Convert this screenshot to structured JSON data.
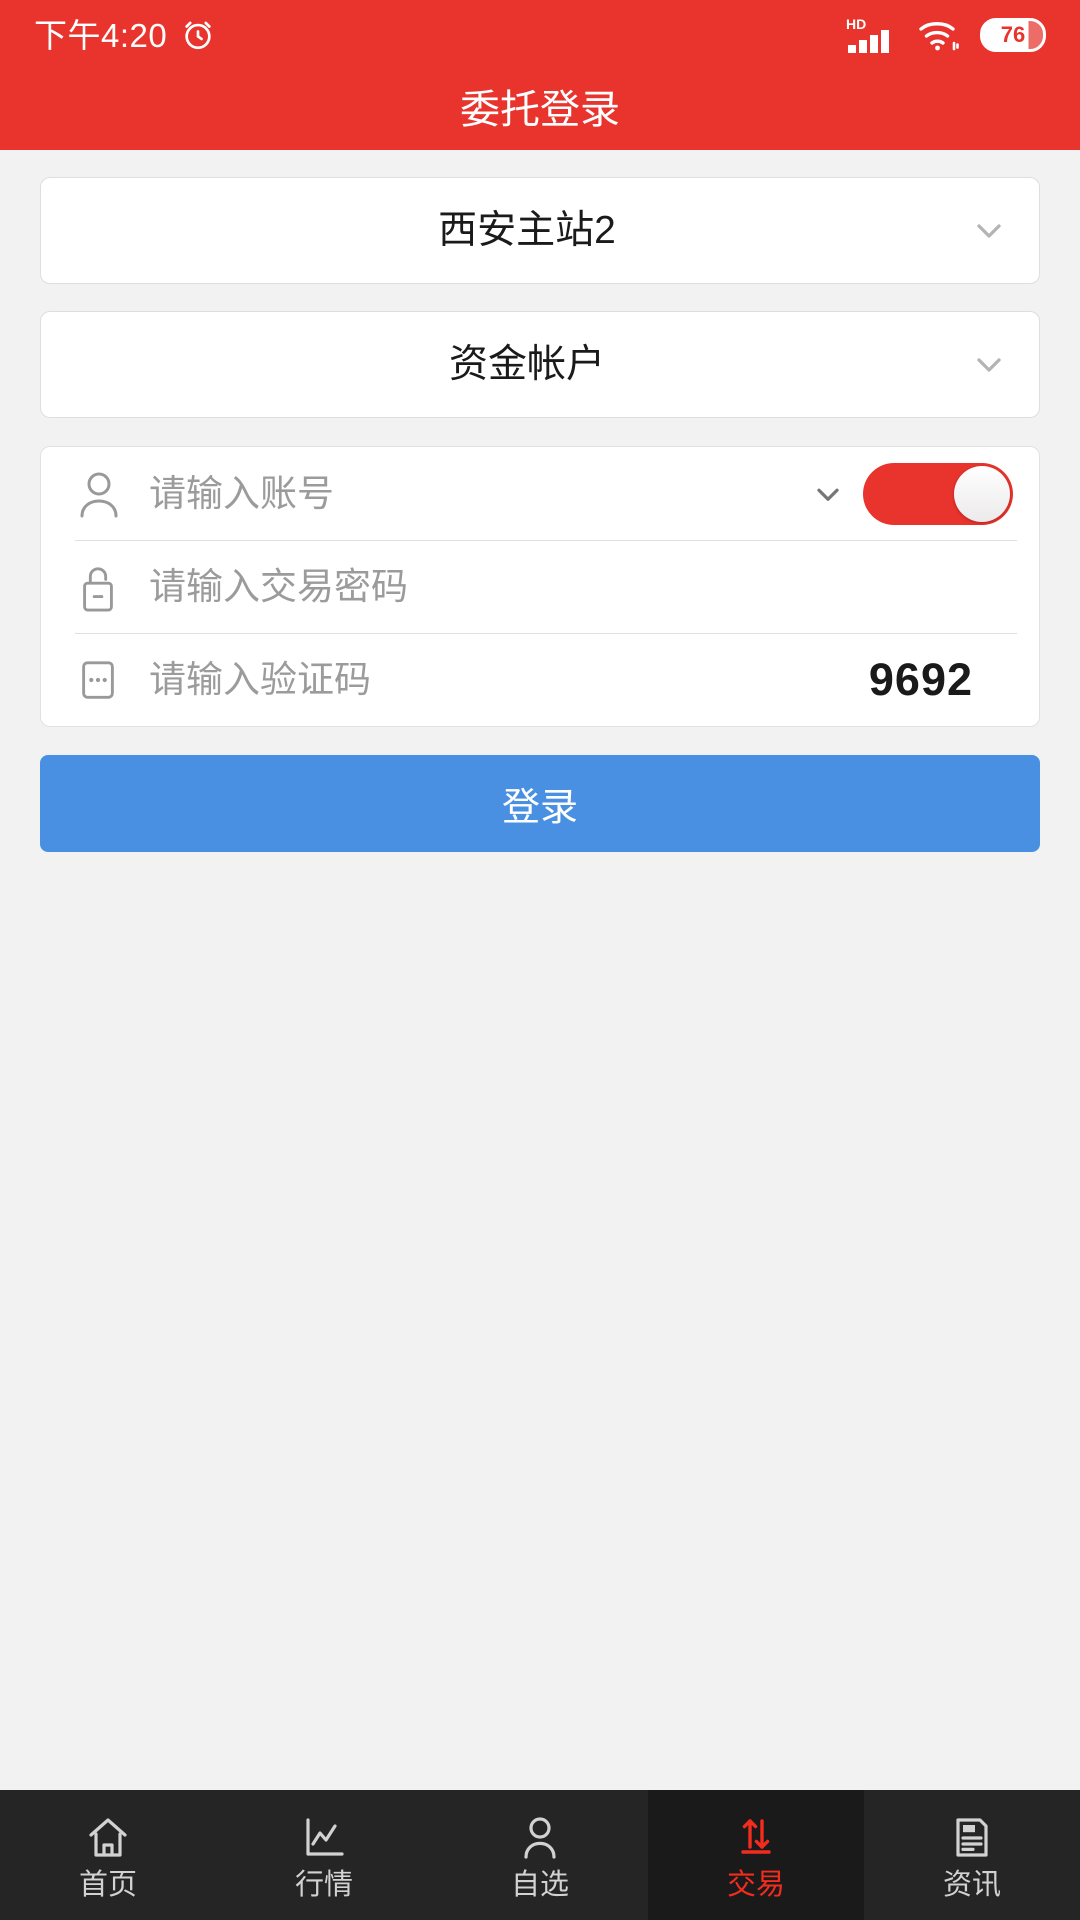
{
  "status_bar": {
    "time": "下午4:20",
    "alarm_icon": "alarm-clock-icon",
    "network_label": "HD",
    "signal_icon": "cellular-signal-icon",
    "wifi_icon": "wifi-icon",
    "battery_percent": "76"
  },
  "app_bar": {
    "title": "委托登录"
  },
  "selectors": [
    {
      "name": "station",
      "value": "西安主站2",
      "icon": "chevron-down-icon"
    },
    {
      "name": "account-type",
      "value": "资金帐户",
      "icon": "chevron-down-icon"
    }
  ],
  "form": {
    "account": {
      "icon": "user-icon",
      "placeholder": "请输入账号",
      "value": "",
      "dropdown_icon": "chevron-down-icon",
      "remember_toggle_on": true
    },
    "password": {
      "icon": "lock-icon",
      "placeholder": "请输入交易密码",
      "value": ""
    },
    "captcha": {
      "icon": "dots-box-icon",
      "placeholder": "请输入验证码",
      "value": "",
      "code": "9692"
    }
  },
  "login_button": {
    "label": "登录"
  },
  "tab_bar": {
    "items": [
      {
        "label": "首页",
        "icon": "home-icon",
        "active": false
      },
      {
        "label": "行情",
        "icon": "chart-icon",
        "active": false
      },
      {
        "label": "自选",
        "icon": "person-icon",
        "active": false
      },
      {
        "label": "交易",
        "icon": "trade-arrows-icon",
        "active": true
      },
      {
        "label": "资讯",
        "icon": "news-icon",
        "active": false
      }
    ]
  },
  "colors": {
    "brand_red": "#e8342c",
    "accent_blue": "#4a90e2",
    "active_tab_red": "#f22c1e",
    "page_bg": "#f2f2f2",
    "tabbar_bg": "#252525"
  }
}
